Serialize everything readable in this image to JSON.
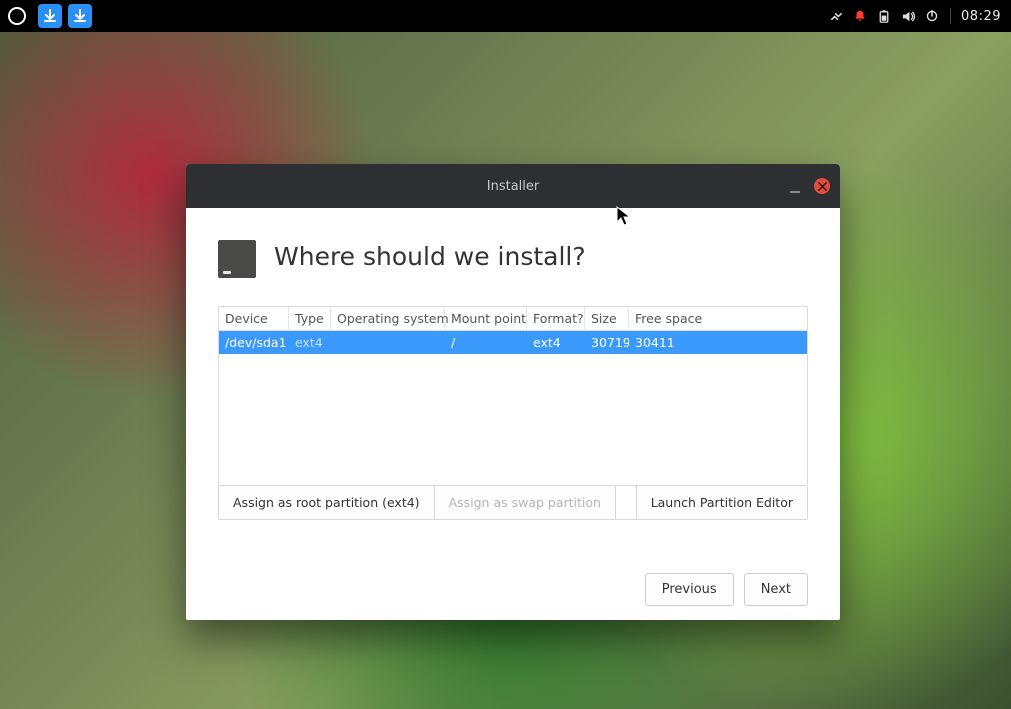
{
  "panel": {
    "clock": "08:29"
  },
  "window": {
    "title": "Installer",
    "heading": "Where should we install?",
    "columns": {
      "device": "Device",
      "type": "Type",
      "os": "Operating system",
      "mount": "Mount point",
      "format": "Format?",
      "size": "Size",
      "free": "Free space"
    },
    "rows": [
      {
        "device": "/dev/sda1",
        "type": "ext4",
        "os": "",
        "mount": "/",
        "format": "ext4",
        "size": "30719",
        "free": "30411"
      }
    ],
    "buttons": {
      "assign_root": "Assign as root partition (ext4)",
      "assign_swap": "Assign as swap partition",
      "launch_editor": "Launch Partition Editor",
      "previous": "Previous",
      "next": "Next"
    }
  }
}
